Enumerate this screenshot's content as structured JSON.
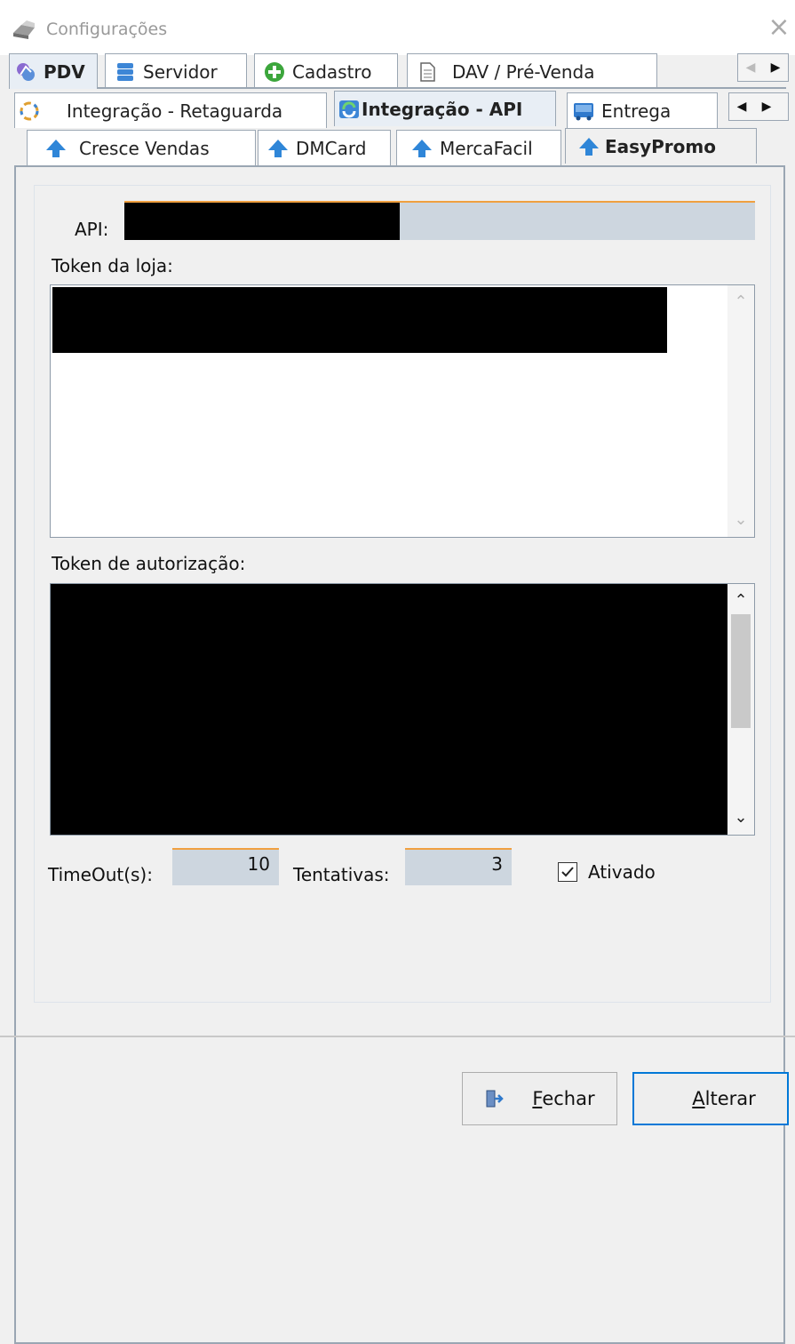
{
  "window": {
    "title": "Configurações"
  },
  "tabs_row1": {
    "items": [
      {
        "label": "PDV",
        "icon": "pdv-icon",
        "selected": true
      },
      {
        "label": "Servidor",
        "icon": "database-icon",
        "selected": false
      },
      {
        "label": "Cadastro",
        "icon": "plus-circle-icon",
        "selected": false
      },
      {
        "label": "DAV / Pré-Venda",
        "icon": "document-icon",
        "selected": false
      }
    ]
  },
  "tabs_row2": {
    "items": [
      {
        "label": "Integração - Retaguarda",
        "icon": "sync-icon",
        "selected": false
      },
      {
        "label": "Integração - API",
        "icon": "api-icon",
        "selected": true
      },
      {
        "label": "Entrega",
        "icon": "delivery-icon",
        "selected": false
      }
    ]
  },
  "tabs_row3": {
    "items": [
      {
        "label": "Cresce Vendas",
        "icon": "arrow-up-icon",
        "selected": false
      },
      {
        "label": "DMCard",
        "icon": "arrow-up-icon",
        "selected": false
      },
      {
        "label": "MercaFacil",
        "icon": "arrow-up-icon",
        "selected": false
      },
      {
        "label": "EasyPromo",
        "icon": "arrow-up-icon",
        "selected": true
      }
    ]
  },
  "form": {
    "api_label": "API:",
    "token_loja_label": "Token da loja:",
    "token_autorizacao_label": "Token de autorização:",
    "timeout_label": "TimeOut(s):",
    "timeout_value": "10",
    "tentativas_label": "Tentativas:",
    "tentativas_value": "3",
    "ativado_label": "Ativado",
    "ativado_checked": true
  },
  "buttons": {
    "fechar": "Fechar",
    "alterar": "Alterar"
  },
  "colors": {
    "accent_orange": "#f0a040",
    "field_bg": "#cdd6df",
    "tab_border": "#9aa6b3",
    "default_button_border": "#0078d7"
  }
}
